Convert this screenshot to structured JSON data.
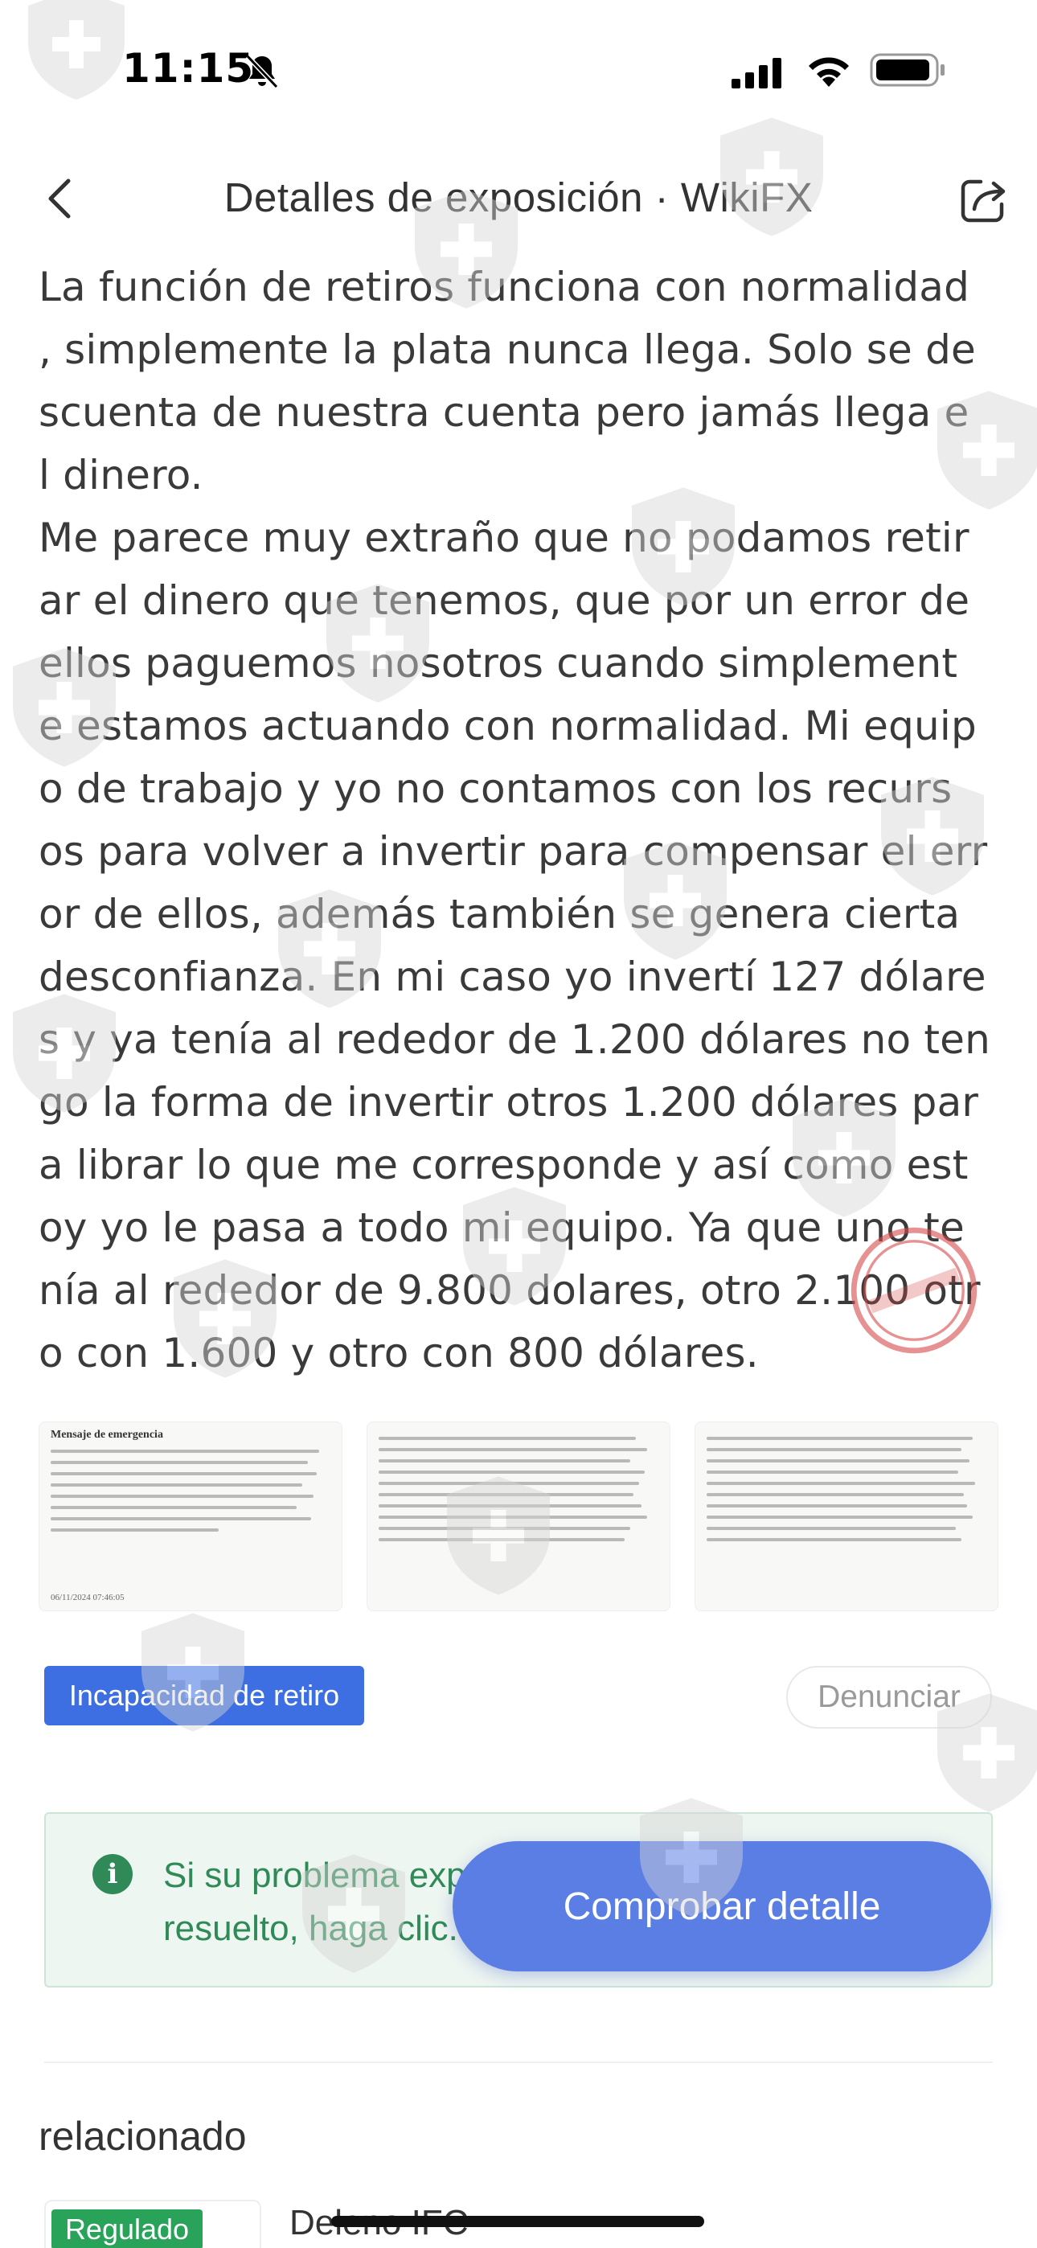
{
  "status_bar": {
    "time": "11:15"
  },
  "nav": {
    "title": "Detalles de exposición · WikiFX"
  },
  "body_text": "La función de retiros funciona con normalidad\n, simplemente la plata nunca llega. Solo se de\nscuenta de nuestra cuenta pero jamás llega e\nl dinero.\nMe parece muy extraño que no podamos retir\nar el dinero que tenemos, que por un error de\nellos paguemos nosotros cuando simplement\ne estamos actuando con normalidad. Mi equip\no de trabajo y yo no contamos con los recurs\nos para volver a invertir para compensar el err\nor de ellos, además también se genera cierta\ndesconfianza. En mi caso yo invertí 127 dólare\ns y ya tenía al rededor de 1.200 dólares no ten\ngo la forma de invertir otros 1.200 dólares par\na librar lo que me corresponde y así como est\noy yo le pasa a todo mi equipo. Ya que uno te\nnía al rededor de 9.800 dolares, otro 2.100 otr\no con 1.600 y otro con 800 dólares.",
  "images": [
    {
      "title": "Mensaje de emergencia",
      "date": "06/11/2024 07:46:05"
    },
    {
      "title": "",
      "date": ""
    },
    {
      "title": "",
      "date": ""
    }
  ],
  "tag": "Incapacidad de retiro",
  "report_label": "Denunciar",
  "notice": {
    "text": "Si su problema expuesto se ha resuelto, haga clic."
  },
  "cta_label": "Comprobar detalle",
  "related": {
    "title": "relacionado",
    "badge": "Regulado",
    "broker": "Deleno IFC"
  },
  "colors": {
    "accent_blue": "#3d6fe2",
    "notice_green": "#2f8a57",
    "badge_green": "#2aa35a",
    "cta_blue": "#5b7ee5"
  }
}
